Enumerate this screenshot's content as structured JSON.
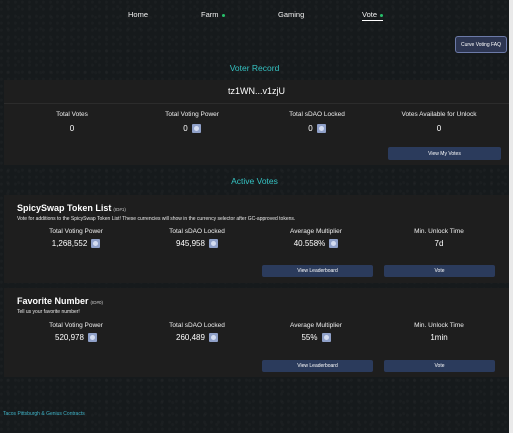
{
  "nav": {
    "home": "Home",
    "farm": "Farm",
    "gaming": "Gaming",
    "vote": "Vote"
  },
  "faq_button": "Curve Voting FAQ",
  "voter_record": {
    "heading": "Voter Record",
    "address": "tz1WN...v1zjU",
    "stats": [
      {
        "label": "Total Votes",
        "value": "0"
      },
      {
        "label": "Total Voting Power",
        "value": "0"
      },
      {
        "label": "Total sDAO Locked",
        "value": "0"
      },
      {
        "label": "Votes Available for Unlock",
        "value": "0"
      }
    ],
    "view_votes_button": "View My Votes"
  },
  "active_votes": {
    "heading": "Active Votes",
    "votes": [
      {
        "title": "SpicySwap Token List",
        "id": "(ID#1)",
        "description": "Vote for additions to the SpicySwap Token List! These currencies will show in the currency selector after GC-approved tokens.",
        "stats": [
          {
            "label": "Total Voting Power",
            "value": "1,268,552"
          },
          {
            "label": "Total sDAO Locked",
            "value": "945,958"
          },
          {
            "label": "Average Multiplier",
            "value": "40.558%"
          },
          {
            "label": "Min. Unlock Time",
            "value": "7d"
          }
        ],
        "leaderboard_button": "View Leaderboard",
        "vote_button": "Vote"
      },
      {
        "title": "Favorite Number",
        "id": "(ID#0)",
        "description": "Tell us your favorite number!",
        "stats": [
          {
            "label": "Total Voting Power",
            "value": "520,978"
          },
          {
            "label": "Total sDAO Locked",
            "value": "260,489"
          },
          {
            "label": "Average Multiplier",
            "value": "55%"
          },
          {
            "label": "Min. Unlock Time",
            "value": "1min"
          }
        ],
        "leaderboard_button": "View Leaderboard",
        "vote_button": "Vote"
      }
    ]
  },
  "footer": "Tacos Pittsburgh & Genius Contracts",
  "colors": {
    "accent": "#35c3c3",
    "button": "#2b3b5c",
    "card": "#1e1e1e",
    "nav_dot": "#27c06b"
  },
  "icons": {
    "token": "sdao-token-icon"
  }
}
